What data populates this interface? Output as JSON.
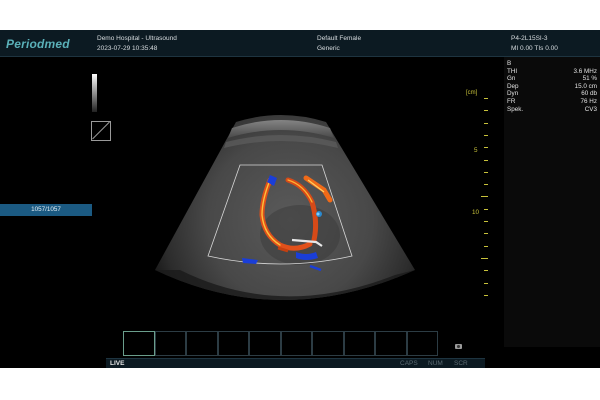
{
  "header": {
    "logo": "Periodmed",
    "hospital": "Demo Hospital - Ultrasound",
    "datetime": "2023-07-29 10:35:48",
    "patient_name": "Default Female",
    "preset": "Generic",
    "probe": "P4-2L15SI-3",
    "mi_tis": "MI 0.00 TIs 0.00"
  },
  "params": {
    "mode": "B",
    "rows": [
      {
        "label": "THI",
        "value": "3.6 MHz"
      },
      {
        "label": "Gn",
        "value": "51 %"
      },
      {
        "label": "Dep",
        "value": "15.0 cm"
      },
      {
        "label": "Dyn",
        "value": "60 db"
      },
      {
        "label": "FR",
        "value": "76 Hz"
      },
      {
        "label": "Spek.",
        "value": "CV3"
      }
    ]
  },
  "frame_counter": "1057/1057",
  "depth_scale": {
    "unit_label": "[cm]",
    "labels": [
      "5",
      "10"
    ]
  },
  "cine": {
    "thumbnail_count": 10
  },
  "status": {
    "mode": "LIVE",
    "caps": "CAPS",
    "num": "NUM",
    "scr": "SCR"
  },
  "icons": [
    "grayscale-bar-icon",
    "orientation-marker-icon",
    "camera-icon"
  ],
  "colors": {
    "accent": "#1b5a82",
    "scale": "#c8c23a",
    "logo": "#5ab0b8",
    "background": "#000000"
  }
}
